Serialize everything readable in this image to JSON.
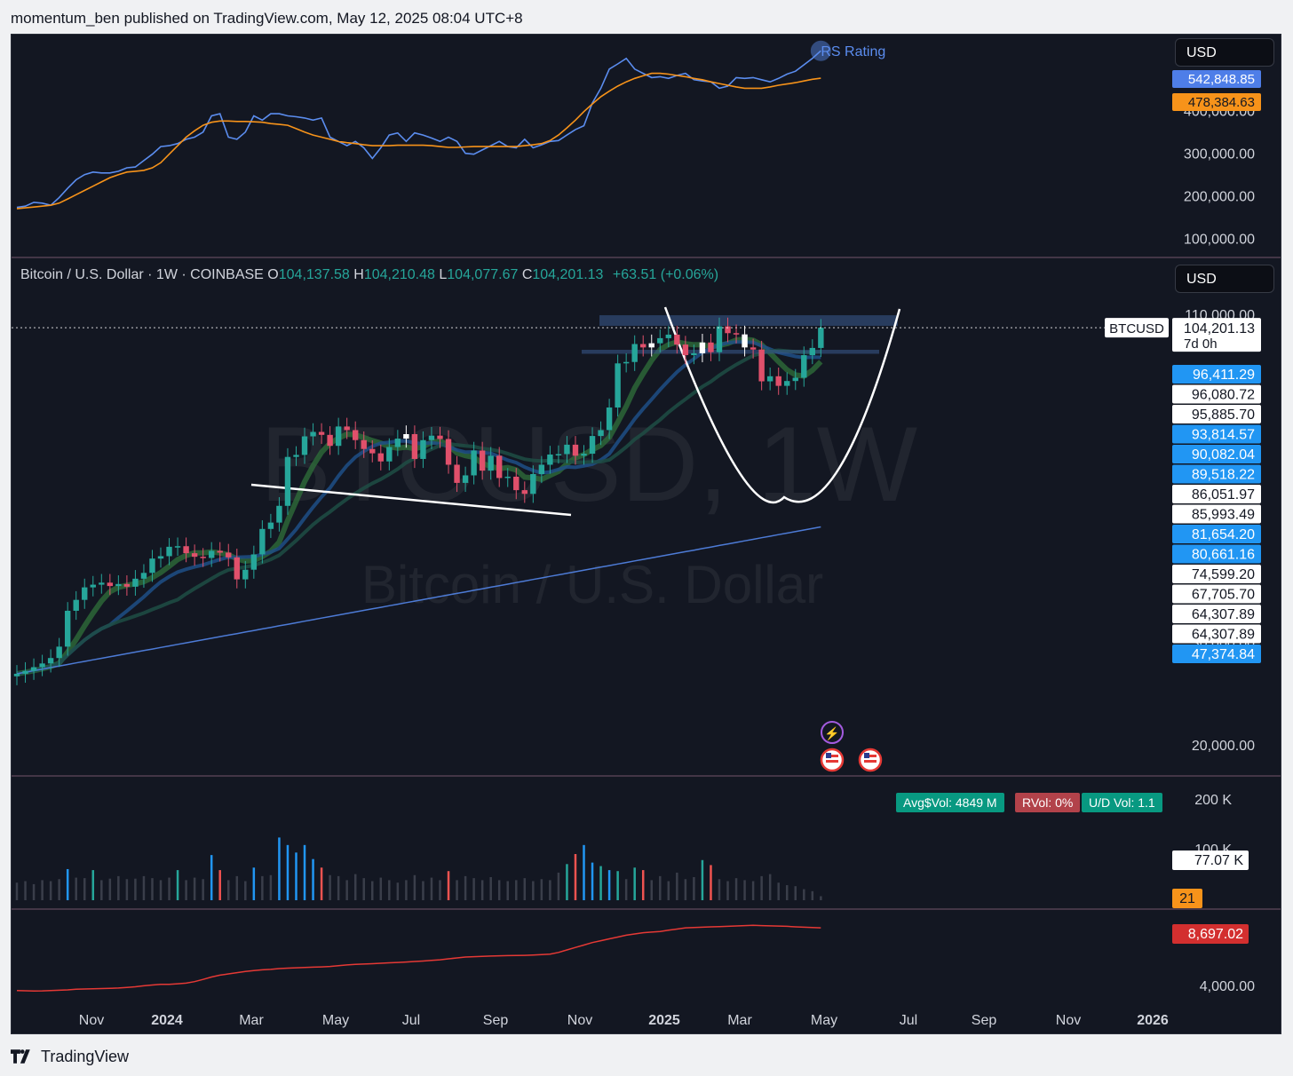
{
  "header": {
    "published_text": "momentum_ben published on TradingView.com, May 12, 2025 08:04 UTC+8"
  },
  "footer": {
    "brand": "TradingView"
  },
  "legend": {
    "symbol": "Bitcoin / U.S. Dollar · 1W · COINBASE",
    "o_label": "O",
    "o": "104,137.58",
    "h_label": "H",
    "h": "104,210.48",
    "l_label": "L",
    "l": "104,077.67",
    "c_label": "C",
    "c": "104,201.13",
    "change": "+63.51 (+0.06%)"
  },
  "watermark": {
    "line1": "BTCUSD, 1W",
    "line2": "Bitcoin / U.S. Dollar"
  },
  "currency_top": "USD",
  "currency_main": "USD",
  "rs_label": "RS Rating",
  "volume_badges": {
    "avg": "Avg$Vol: 4849 M",
    "rvol": "RVol: 0%",
    "ud": "U/D Vol: 1.1"
  },
  "colors": {
    "bg": "#131722",
    "up": "#26a69a",
    "down": "#e0506b",
    "white_candle": "#ffffff",
    "rs_line": "#5b8def",
    "rs_ma": "#f7931a",
    "ad_line": "#e53935",
    "badge_blue": "#2962ff",
    "badge_orange": "#f7931a",
    "badge_red": "#d32f2f",
    "vol_blue": "#2196f3",
    "vol_red": "#ef5350",
    "vol_green": "#26a69a"
  },
  "chart_data": [
    {
      "panel": "rs_rating",
      "type": "line",
      "title": "RS Rating",
      "yaxis_ticks": [
        "400,000.00",
        "300,000.00",
        "200,000.00",
        "100,000.00"
      ],
      "ylim": [
        70000,
        560000
      ],
      "series": [
        {
          "name": "RS Rating",
          "values": [
            175000,
            178000,
            187000,
            185000,
            180000,
            198000,
            220000,
            240000,
            252000,
            258000,
            256000,
            256000,
            260000,
            268000,
            270000,
            285000,
            300000,
            318000,
            320000,
            325000,
            335000,
            340000,
            352000,
            390000,
            395000,
            340000,
            335000,
            352000,
            390000,
            380000,
            395000,
            395000,
            390000,
            388000,
            385000,
            380000,
            385000,
            340000,
            330000,
            320000,
            330000,
            315000,
            290000,
            315000,
            345000,
            350000,
            330000,
            350000,
            345000,
            338000,
            330000,
            340000,
            330000,
            302000,
            300000,
            310000,
            320000,
            330000,
            318000,
            315000,
            335000,
            315000,
            322000,
            330000,
            332000,
            345000,
            358000,
            367000,
            420000,
            455000,
            500000,
            512000,
            525000,
            500000,
            490000,
            480000,
            482000,
            478000,
            485000,
            490000,
            475000,
            472000,
            470000,
            455000,
            460000,
            480000,
            478000,
            480000,
            475000,
            470000,
            478000,
            488000,
            495000,
            510000,
            525000,
            542848.85
          ]
        },
        {
          "name": "RS MA",
          "values": [
            172000,
            174000,
            176000,
            178000,
            180000,
            185000,
            195000,
            205000,
            215000,
            225000,
            235000,
            245000,
            252000,
            258000,
            260000,
            262000,
            268000,
            280000,
            300000,
            320000,
            340000,
            355000,
            368000,
            375000,
            378000,
            378000,
            377000,
            377000,
            376000,
            375000,
            372000,
            370000,
            368000,
            360000,
            352000,
            345000,
            340000,
            335000,
            330000,
            327000,
            325000,
            322000,
            320000,
            320000,
            320000,
            321000,
            321000,
            321000,
            321000,
            320000,
            318000,
            316000,
            316000,
            317000,
            318000,
            318000,
            318000,
            318000,
            318000,
            318000,
            320000,
            322000,
            325000,
            332000,
            345000,
            362000,
            380000,
            400000,
            418000,
            435000,
            448000,
            460000,
            470000,
            478000,
            484000,
            490000,
            490000,
            488000,
            485000,
            482000,
            478000,
            475000,
            470000,
            466000,
            462000,
            458000,
            455000,
            455000,
            455000,
            458000,
            462000,
            465000,
            468000,
            472000,
            476000,
            478384.63
          ]
        }
      ],
      "price_labels": [
        "542,848.85",
        "478,384.63"
      ]
    },
    {
      "panel": "price",
      "type": "candlestick",
      "title": "Bitcoin / U.S. Dollar · 1W · COINBASE",
      "x_ticks": [
        "Nov",
        "2024",
        "Mar",
        "May",
        "Jul",
        "Sep",
        "Nov",
        "2025",
        "Mar",
        "May",
        "Jul",
        "Sep",
        "Nov",
        "2026"
      ],
      "y_ticks": [
        "110,000.00",
        "30,000.00",
        "20,000.00"
      ],
      "current_price": "104,201.13",
      "countdown": "7d 0h",
      "symbol_tag": "BTCUSD",
      "price_labels": [
        {
          "value": "96,411.29",
          "style": "blue"
        },
        {
          "value": "96,080.72",
          "style": "white"
        },
        {
          "value": "95,885.70",
          "style": "white"
        },
        {
          "value": "93,814.57",
          "style": "blue"
        },
        {
          "value": "90,082.04",
          "style": "blue"
        },
        {
          "value": "89,518.22",
          "style": "blue"
        },
        {
          "value": "86,051.97",
          "style": "white"
        },
        {
          "value": "85,993.49",
          "style": "white"
        },
        {
          "value": "81,654.20",
          "style": "blue"
        },
        {
          "value": "80,661.16",
          "style": "blue"
        },
        {
          "value": "74,599.20",
          "style": "white"
        },
        {
          "value": "67,705.70",
          "style": "white"
        },
        {
          "value": "64,307.89",
          "style": "white"
        },
        {
          "value": "64,307.89",
          "style": "white"
        },
        {
          "value": "47,374.84",
          "style": "blue"
        }
      ],
      "ylim_log": [
        18000,
        120000
      ],
      "candles_close": [
        26500,
        26800,
        27200,
        27600,
        28200,
        29500,
        34000,
        35500,
        37300,
        37700,
        38000,
        37500,
        37800,
        37400,
        38600,
        39500,
        41800,
        42200,
        43800,
        43900,
        42700,
        42100,
        41900,
        43100,
        42800,
        42000,
        38500,
        40000,
        42500,
        47000,
        48200,
        51500,
        62500,
        63000,
        67800,
        69000,
        68200,
        65300,
        70500,
        69500,
        66800,
        64500,
        63400,
        61400,
        65000,
        67200,
        68400,
        62000,
        66800,
        68000,
        67100,
        60600,
        56400,
        58100,
        64100,
        59200,
        62800,
        57500,
        57800,
        54800,
        54000,
        58400,
        60600,
        63100,
        63200,
        65600,
        62800,
        63300,
        67900,
        69500,
        76000,
        90500,
        91000,
        97700,
        96400,
        98000,
        100000,
        101400,
        97500,
        93500,
        94200,
        98300,
        94600,
        104800,
        102000,
        101500,
        96400,
        95600,
        84300,
        86000,
        82800,
        84400,
        85500,
        93500,
        96200,
        104201.13
      ],
      "resistance_zone": [
        105000,
        109500
      ],
      "support_zone": [
        94000,
        95500
      ],
      "trendline": "descending from ~73,800 (Mar 2024) to ~67,000 (Oct 2024)",
      "pattern": "cup (white arc) from Dec 2024 to May 2025"
    },
    {
      "panel": "volume",
      "type": "bar",
      "y_ticks": [
        "200 K",
        "100 K"
      ],
      "current_volume": "77.07 K",
      "ma_label": "21",
      "values": [
        35,
        38,
        32,
        40,
        38,
        42,
        62,
        45,
        44,
        60,
        40,
        43,
        48,
        42,
        43,
        48,
        44,
        40,
        45,
        60,
        40,
        45,
        42,
        90,
        60,
        40,
        48,
        38,
        65,
        48,
        50,
        125,
        110,
        95,
        110,
        82,
        65,
        50,
        48,
        40,
        52,
        44,
        38,
        45,
        40,
        35,
        40,
        50,
        38,
        45,
        40,
        58,
        40,
        48,
        44,
        40,
        46,
        40,
        38,
        40,
        44,
        38,
        42,
        40,
        55,
        72,
        92,
        110,
        75,
        68,
        60,
        58,
        42,
        65,
        60,
        40,
        48,
        38,
        55,
        42,
        46,
        80,
        70,
        42,
        38,
        44,
        40,
        38,
        48,
        52,
        35,
        30,
        28,
        22,
        18,
        8
      ]
    },
    {
      "panel": "ad_line",
      "type": "line",
      "y_ticks": [
        "4,000.00"
      ],
      "current_value": "8,697.02",
      "values": [
        3600,
        3580,
        3560,
        3570,
        3600,
        3620,
        3650,
        3700,
        3720,
        3740,
        3760,
        3780,
        3800,
        3850,
        3900,
        3980,
        4050,
        4100,
        4100,
        4150,
        4200,
        4320,
        4500,
        4700,
        4850,
        4950,
        5050,
        5150,
        5220,
        5280,
        5320,
        5380,
        5420,
        5450,
        5480,
        5500,
        5520,
        5560,
        5620,
        5680,
        5720,
        5750,
        5780,
        5820,
        5850,
        5880,
        5920,
        5960,
        6000,
        6050,
        6100,
        6180,
        6250,
        6320,
        6350,
        6380,
        6400,
        6420,
        6440,
        6450,
        6460,
        6480,
        6520,
        6560,
        6700,
        6900,
        7100,
        7300,
        7500,
        7650,
        7800,
        7950,
        8100,
        8200,
        8300,
        8350,
        8400,
        8500,
        8600,
        8700,
        8720,
        8750,
        8780,
        8800,
        8820,
        8850,
        8880,
        8900,
        8880,
        8860,
        8840,
        8820,
        8780,
        8750,
        8720,
        8697.02
      ]
    }
  ]
}
